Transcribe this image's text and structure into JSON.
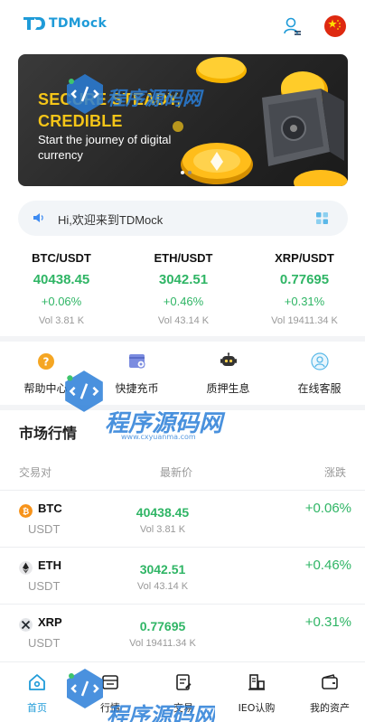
{
  "header": {
    "logo_text": "TDMock",
    "logo_mark_text": "TD",
    "brand_color": "#1f9bd8",
    "user_icon": "user-service-icon",
    "flag_icon": "china-flag-icon"
  },
  "banner": {
    "headline_line1": "SECURE STEADY,",
    "headline_line2": "CREDIBLE",
    "subtitle": "Start the journey of digital currency",
    "slides": 2,
    "active_slide": 1
  },
  "notice": {
    "text": "Hi,欢迎来到TDMock",
    "speaker_icon": "speaker-icon",
    "grid_icon": "grid-icon"
  },
  "tickers": [
    {
      "pair": "BTC/USDT",
      "price": "40438.45",
      "change": "+0.06%",
      "volume": "Vol 3.81 K"
    },
    {
      "pair": "ETH/USDT",
      "price": "3042.51",
      "change": "+0.46%",
      "volume": "Vol 43.14 K"
    },
    {
      "pair": "XRP/USDT",
      "price": "0.77695",
      "change": "+0.31%",
      "volume": "Vol 19411.34 K"
    }
  ],
  "quick_links": [
    {
      "label": "帮助中心",
      "icon": "help-icon"
    },
    {
      "label": "快捷充币",
      "icon": "deposit-icon"
    },
    {
      "label": "质押生息",
      "icon": "staking-robot-icon"
    },
    {
      "label": "在线客服",
      "icon": "support-icon"
    }
  ],
  "market": {
    "title": "市场行情",
    "col_pair": "交易对",
    "col_price": "最新价",
    "col_change": "涨跌",
    "rows": [
      {
        "symbol": "BTC",
        "quote": "USDT",
        "price": "40438.45",
        "volume": "Vol 3.81 K",
        "change": "+0.06%",
        "icon": "btc-coin-icon"
      },
      {
        "symbol": "ETH",
        "quote": "USDT",
        "price": "3042.51",
        "volume": "Vol 43.14 K",
        "change": "+0.46%",
        "icon": "eth-coin-icon"
      },
      {
        "symbol": "XRP",
        "quote": "USDT",
        "price": "0.77695",
        "volume": "Vol 19411.34 K",
        "change": "+0.31%",
        "icon": "xrp-coin-icon"
      }
    ]
  },
  "tabbar": [
    {
      "label": "首页",
      "icon": "home-icon",
      "active": true
    },
    {
      "label": "行情",
      "icon": "market-icon",
      "active": false
    },
    {
      "label": "交易",
      "icon": "trade-icon",
      "active": false
    },
    {
      "label": "IEO认购",
      "icon": "ieo-icon",
      "active": false
    },
    {
      "label": "我的资产",
      "icon": "wallet-icon",
      "active": false
    }
  ],
  "watermark": {
    "text": "程序源码网",
    "url": "www.cxyuanma.com"
  },
  "colors": {
    "up_green": "#2fb565",
    "accent_blue": "#1f9bd8",
    "banner_gold": "#f5c518",
    "muted_gray": "#999999"
  }
}
